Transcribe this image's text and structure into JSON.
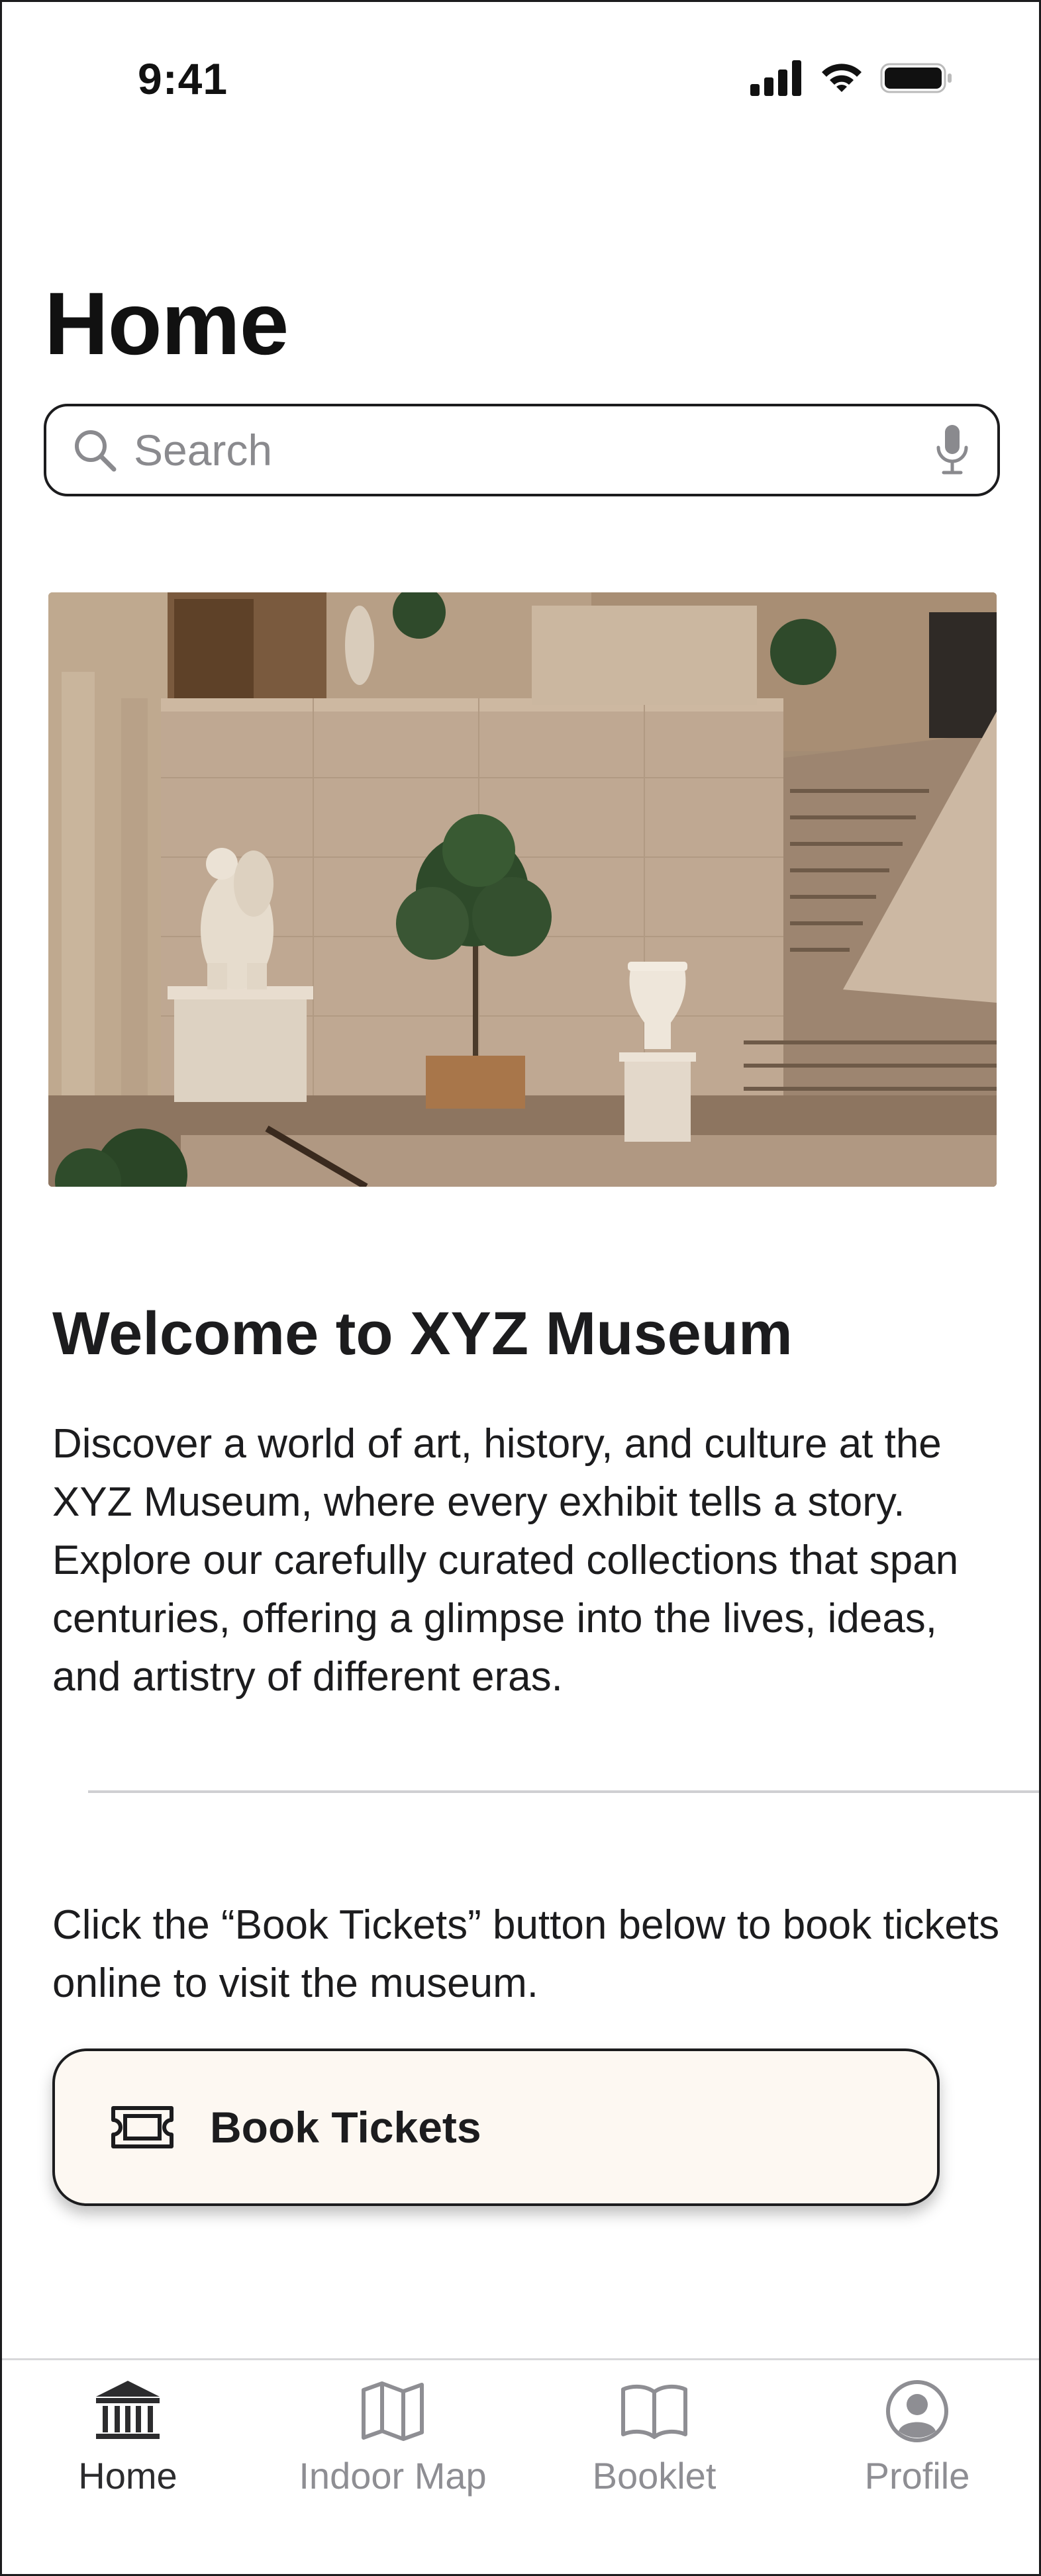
{
  "status_bar": {
    "time": "9:41",
    "icons": [
      "cellular-signal-icon",
      "wifi-icon",
      "battery-icon"
    ]
  },
  "page": {
    "title": "Home"
  },
  "search": {
    "placeholder": "Search",
    "leading_icon": "search-icon",
    "trailing_icon": "microphone-icon"
  },
  "hero": {
    "alt": "Museum hall with marble statues, potted tree, urn and staircase"
  },
  "welcome": {
    "title": "Welcome to XYZ Museum",
    "body": "Discover a world of art, history, and culture at the XYZ Museum, where every exhibit tells a story. Explore our carefully curated collections that span centuries, offering a glimpse into the lives, ideas, and artistry of different eras."
  },
  "booking": {
    "instructions": "Click the “Book Tickets” button below to book tickets online to visit the museum.",
    "button_label": "Book Tickets",
    "button_icon": "ticket-icon"
  },
  "tab_bar": {
    "tabs": [
      {
        "label": "Home",
        "icon": "museum-icon",
        "active": true
      },
      {
        "label": "Indoor Map",
        "icon": "map-icon",
        "active": false
      },
      {
        "label": "Booklet",
        "icon": "book-icon",
        "active": false
      },
      {
        "label": "Profile",
        "icon": "profile-icon",
        "active": false
      }
    ]
  },
  "colors": {
    "text": "#1c1c1e",
    "inactive_tab": "#8e8e93",
    "button_background": "#fdf8f2",
    "divider": "#cfcfd2"
  }
}
